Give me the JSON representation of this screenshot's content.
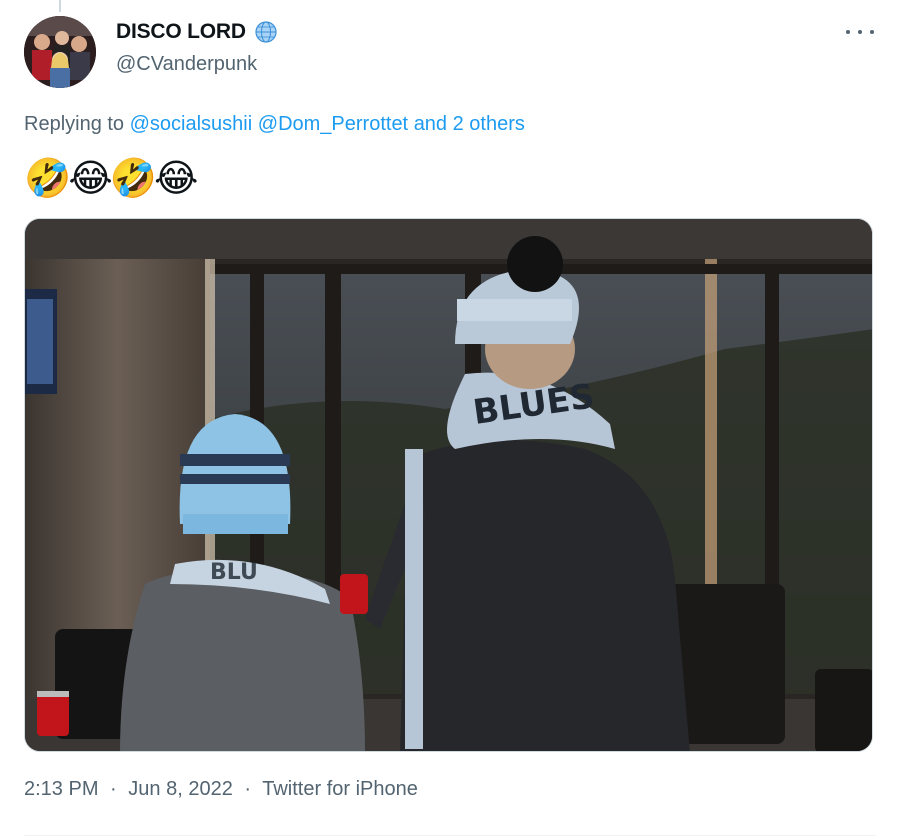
{
  "tweet": {
    "display_name": "DISCO LORD",
    "handle": "@CVanderpunk",
    "reply_prefix": "Replying to",
    "reply_mentions": [
      "@socialsushii",
      "@Dom_Perrottet"
    ],
    "reply_others": "and 2 others",
    "emoji_text": "🤣😂🤣😂",
    "time": "2:13 PM",
    "date": "Jun 8, 2022",
    "source": "Twitter for iPhone",
    "separator": "·",
    "scarf_text": "BLUES"
  },
  "colors": {
    "link": "#1d9bf0",
    "secondary": "#536471",
    "primary": "#0f1419"
  },
  "icons": {
    "more": "more-options-icon",
    "badge": "globe-icon"
  }
}
